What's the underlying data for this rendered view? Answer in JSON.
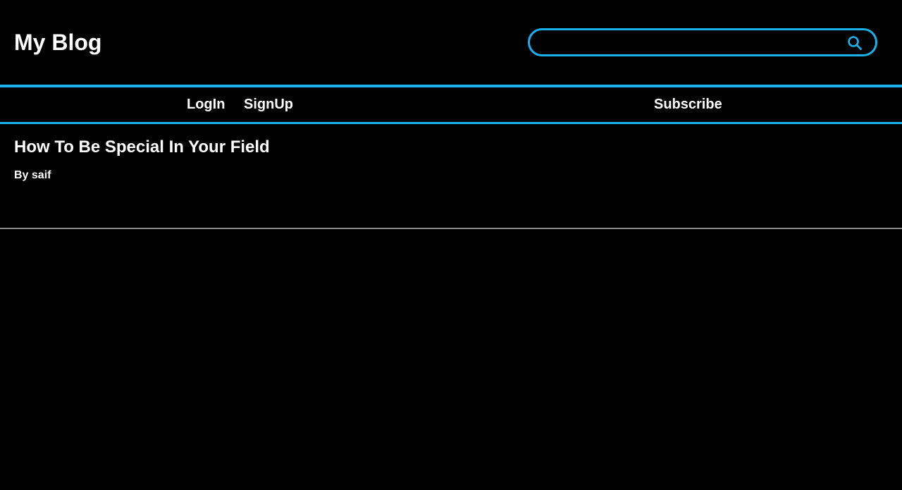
{
  "header": {
    "site_title": "My Blog",
    "search": {
      "placeholder": "",
      "value": "",
      "icon": "search-icon"
    }
  },
  "nav": {
    "login_label": "LogIn",
    "signup_label": "SignUp",
    "subscribe_label": "Subscribe"
  },
  "posts": [
    {
      "title": "How To Be Special In Your Field",
      "author_line": "By saif"
    }
  ],
  "colors": {
    "accent": "#1ab0ec",
    "background": "#000000",
    "text": "#ffffff",
    "divider": "#8a8a8a"
  }
}
